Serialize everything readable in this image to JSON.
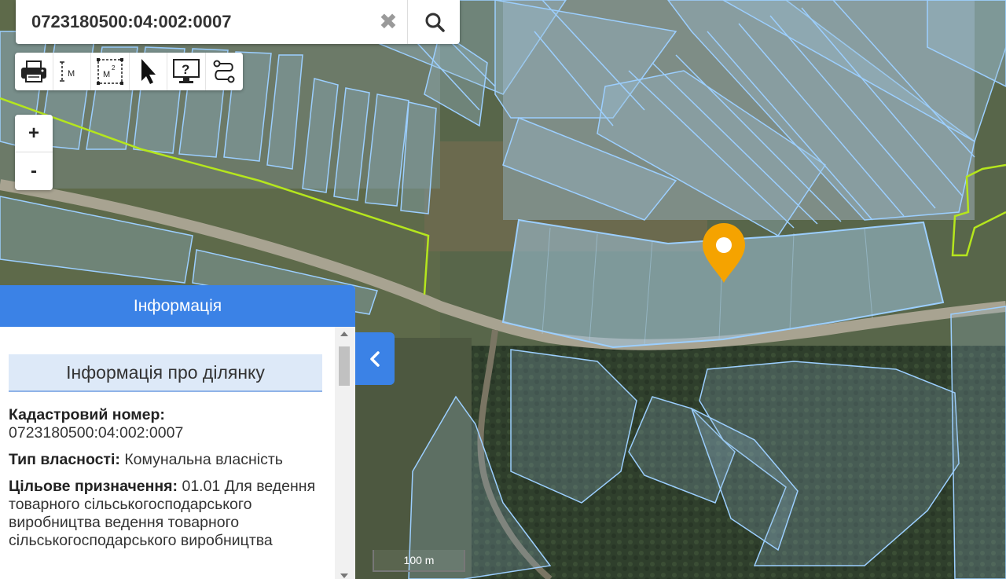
{
  "search": {
    "value": "0723180500:04:002:0007",
    "clear_icon": "close-icon",
    "search_icon": "search-icon"
  },
  "toolbar": {
    "tools": [
      {
        "name": "print-icon"
      },
      {
        "name": "measure-distance-icon",
        "label": "M"
      },
      {
        "name": "measure-area-icon",
        "label": "M",
        "sup": "2"
      },
      {
        "name": "pointer-icon"
      },
      {
        "name": "help-icon"
      },
      {
        "name": "route-icon"
      }
    ]
  },
  "zoom": {
    "in": "+",
    "out": "-"
  },
  "info": {
    "header": "Інформація",
    "subtitle": "Інформація про ділянку",
    "cadastral_label": "Кадастровий номер:",
    "cadastral_value": "0723180500:04:002:0007",
    "ownership_label": "Тип власності:",
    "ownership_value": "Комунальна власність",
    "purpose_label": "Цільове призначення:",
    "purpose_value": "01.01 Для ведення товарного сільськогосподарського виробництва ведення товарного сільськогосподарського виробництва"
  },
  "scale": {
    "label": "100 m"
  },
  "colors": {
    "accent": "#3b82e6",
    "parcel": "#9ccfff",
    "boundary": "#b5e61d",
    "marker": "#f5a300"
  }
}
